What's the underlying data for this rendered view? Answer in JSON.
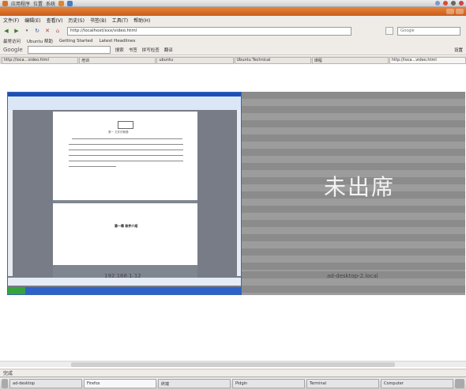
{
  "colors": {
    "titlebar": "#d7702c",
    "absent_bg": "#8b8b8b",
    "absent_text": "#f2f2f2"
  },
  "top_panel": {
    "menus": [
      "应用程序",
      "位置",
      "系统"
    ]
  },
  "window": {
    "title": ""
  },
  "menu_bar": {
    "items": [
      "文件(F)",
      "编辑(E)",
      "查看(V)",
      "历史(S)",
      "书签(B)",
      "工具(T)",
      "帮助(H)"
    ]
  },
  "nav": {
    "url": "http://localhost/xxx/video.html",
    "search_placeholder": "Google"
  },
  "bookmarks": {
    "items": [
      "最常访问",
      "Ubuntu 帮助",
      "Getting Started",
      "Latest Headlines"
    ]
  },
  "google_bar": {
    "logo": "Google",
    "items": [
      "搜索",
      "书签",
      "拼写检查",
      "翻译"
    ],
    "right": "设置"
  },
  "tabs": [
    {
      "label": "http://loca...video.html"
    },
    {
      "label": "培训"
    },
    {
      "label": "ubuntu"
    },
    {
      "label": "Ubuntu Technical"
    },
    {
      "label": "课程"
    },
    {
      "label": "http://loca...video.html"
    }
  ],
  "content": {
    "left_caption": "192.168.1.12",
    "right_caption": "ad-desktop-2.local",
    "absent_label": "未出席",
    "doc_heading": "第一  文件的概要",
    "doc_page2_title": "第一章  软件介绍"
  },
  "status": {
    "text": "完成"
  },
  "taskbar": {
    "items": [
      {
        "label": "ad-desktop",
        "active": false
      },
      {
        "label": "Firefox",
        "active": true
      },
      {
        "label": "终端",
        "active": false
      },
      {
        "label": "Pidgin",
        "active": false
      },
      {
        "label": "Terminal",
        "active": false
      },
      {
        "label": "Computer",
        "active": false
      }
    ]
  }
}
